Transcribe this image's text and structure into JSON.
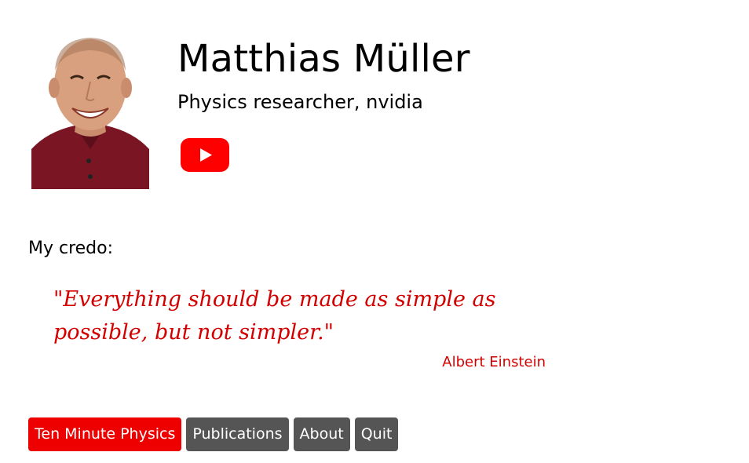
{
  "profile": {
    "name": "Matthias Müller",
    "subtitle": "Physics researcher, nvidia",
    "photo_alt": "Matthias Müller portrait",
    "youtube_icon": "youtube-icon"
  },
  "credo": {
    "label": "My credo:",
    "quote": "\"Everything should be made as simple as possible, but not simpler.\"",
    "author": "Albert Einstein"
  },
  "menu": {
    "items": [
      {
        "label": "Ten Minute Physics",
        "active": true
      },
      {
        "label": "Publications",
        "active": false
      },
      {
        "label": "About",
        "active": false
      },
      {
        "label": "Quit",
        "active": false
      }
    ]
  },
  "colors": {
    "accent": "#ee0000",
    "quote": "#d40000",
    "button": "#555555",
    "youtube": "#ff0000"
  }
}
